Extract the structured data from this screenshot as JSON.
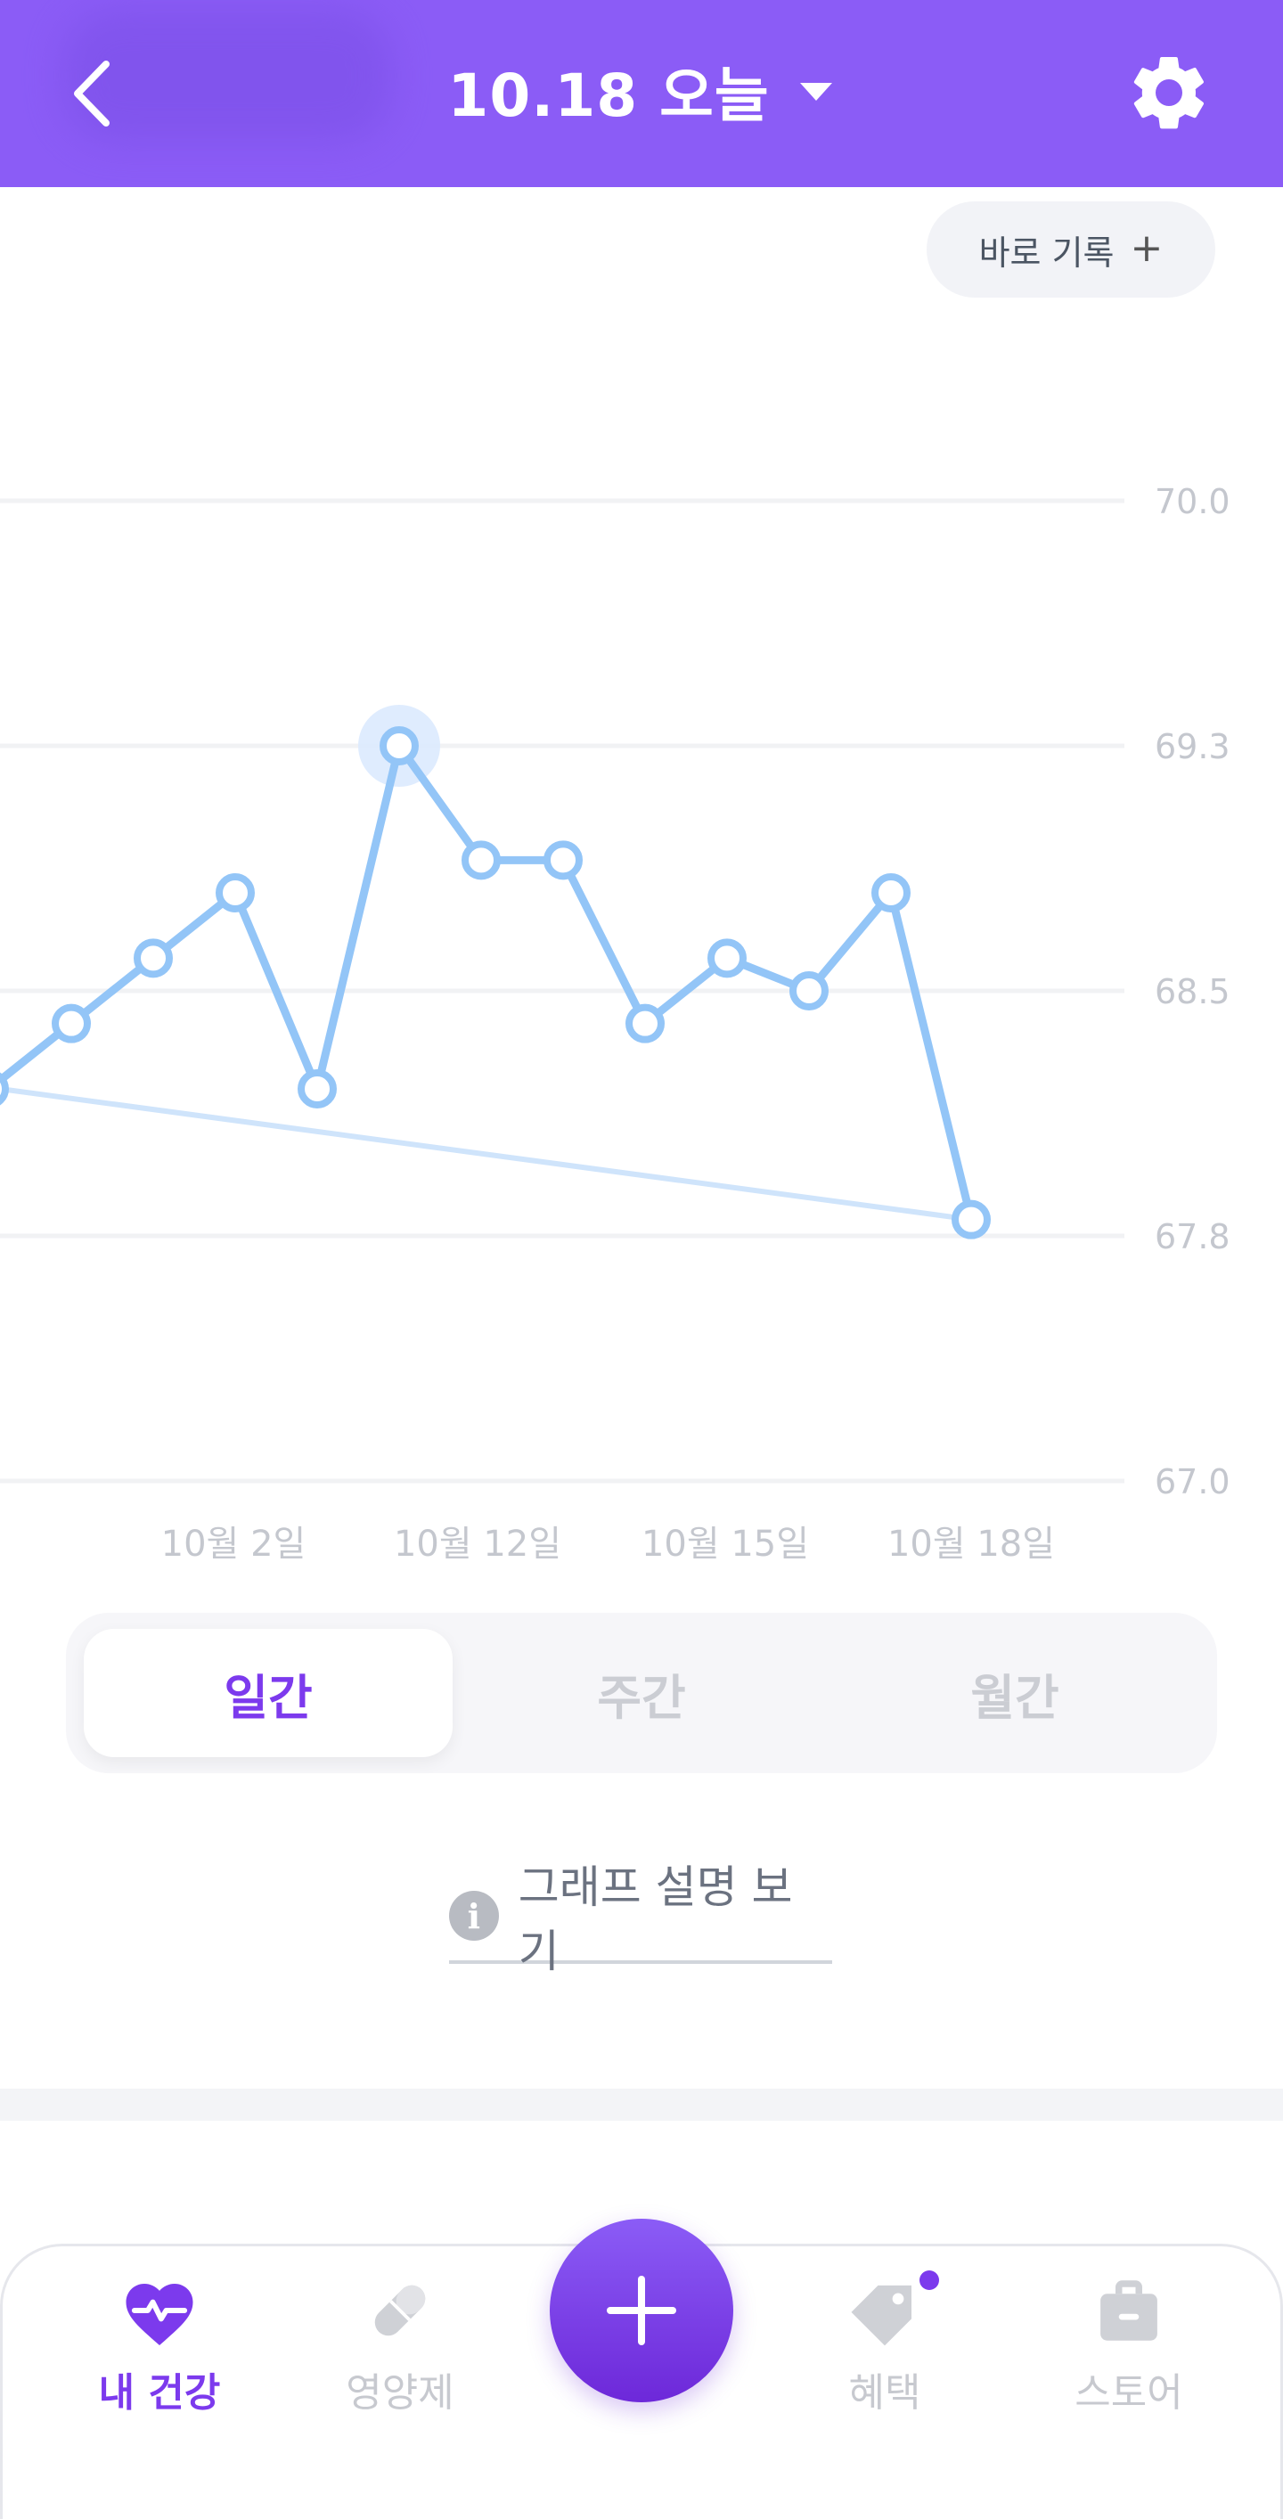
{
  "header": {
    "title": "10.18 오늘",
    "back_icon": "chevron-left-icon",
    "dropdown_icon": "caret-down-icon",
    "settings_icon": "gear-icon",
    "bg_color": "#8b5cf6"
  },
  "quick_record": {
    "label": "바로 기록",
    "plus": "+"
  },
  "chart_data": {
    "type": "line",
    "y_ticks": [
      "70.0",
      "69.3",
      "68.5",
      "67.8",
      "67.0"
    ],
    "ylim": [
      67.0,
      70.0
    ],
    "x_ticks": [
      "10월 2일",
      "10월 12일",
      "10월 15일",
      "10월 18일"
    ],
    "series": [
      {
        "values": [
          68.2,
          68.4,
          68.6,
          68.8,
          68.2,
          69.25,
          68.9,
          68.9,
          68.4,
          68.6,
          68.5,
          68.8,
          67.8
        ]
      }
    ],
    "trend_line": {
      "start": 68.2,
      "end": 67.8
    },
    "highlighted_point_index": 5,
    "line_color": "#93c5f7",
    "grid": true
  },
  "period_tabs": [
    {
      "label": "일간",
      "active": true
    },
    {
      "label": "주간",
      "active": false
    },
    {
      "label": "월간",
      "active": false
    }
  ],
  "graph_help": {
    "label": "그래프 설명 보기",
    "icon": "info-icon"
  },
  "bottom_nav": {
    "items": [
      {
        "label": "내 건강",
        "icon": "heart-pulse-icon",
        "active": true
      },
      {
        "label": "영양제",
        "icon": "pill-icon",
        "active": false
      },
      {
        "label": "혜택",
        "icon": "tag-icon",
        "active": false,
        "badge": true
      },
      {
        "label": "스토어",
        "icon": "store-bag-icon",
        "active": false
      }
    ],
    "fab_icon": "plus-icon",
    "accent_color": "#7c3aed"
  }
}
